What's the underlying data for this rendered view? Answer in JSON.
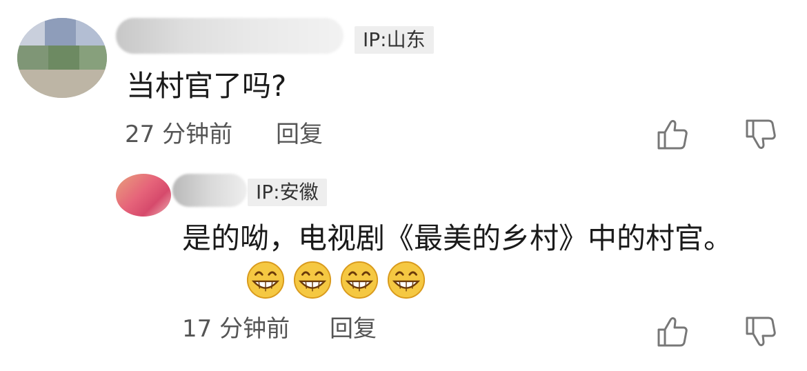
{
  "comments": [
    {
      "ip": "IP:山东",
      "text": "当村官了吗?",
      "time": "27 分钟前",
      "reply_label": "回复"
    },
    {
      "ip": "IP:安徽",
      "text": "是的呦，电视剧《最美的乡村》中的村官。",
      "time": "17 分钟前",
      "reply_label": "回复",
      "emojis": [
        "grin-emoji",
        "grin-emoji",
        "grin-emoji",
        "grin-emoji"
      ]
    }
  ],
  "icons": {
    "like": "thumbs-up-icon",
    "dislike": "thumbs-down-icon"
  },
  "colors": {
    "text": "#1a1a1a",
    "meta": "#555555",
    "badge_bg": "#eeeeee",
    "emoji_face": "#f5c842"
  }
}
